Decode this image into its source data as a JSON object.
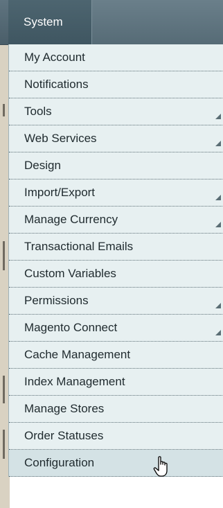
{
  "menu": {
    "title": "System",
    "items": [
      {
        "label": "My Account",
        "has_submenu": false
      },
      {
        "label": "Notifications",
        "has_submenu": false
      },
      {
        "label": "Tools",
        "has_submenu": true
      },
      {
        "label": "Web Services",
        "has_submenu": true
      },
      {
        "label": "Design",
        "has_submenu": false
      },
      {
        "label": "Import/Export",
        "has_submenu": true
      },
      {
        "label": "Manage Currency",
        "has_submenu": true
      },
      {
        "label": "Transactional Emails",
        "has_submenu": false
      },
      {
        "label": "Custom Variables",
        "has_submenu": false
      },
      {
        "label": "Permissions",
        "has_submenu": true
      },
      {
        "label": "Magento Connect",
        "has_submenu": true
      },
      {
        "label": "Cache Management",
        "has_submenu": false
      },
      {
        "label": "Index Management",
        "has_submenu": false
      },
      {
        "label": "Manage Stores",
        "has_submenu": false
      },
      {
        "label": "Order Statuses",
        "has_submenu": false
      },
      {
        "label": "Configuration",
        "has_submenu": false,
        "hovered": true
      }
    ]
  },
  "colors": {
    "menubar": "#4a5e69",
    "dropdown_bg": "#e7f0f1",
    "hover_bg": "#d4e2e5",
    "text": "#1f2a2e"
  },
  "icons": {
    "submenu": "submenu-arrow-icon",
    "cursor": "hand-pointer-icon"
  }
}
